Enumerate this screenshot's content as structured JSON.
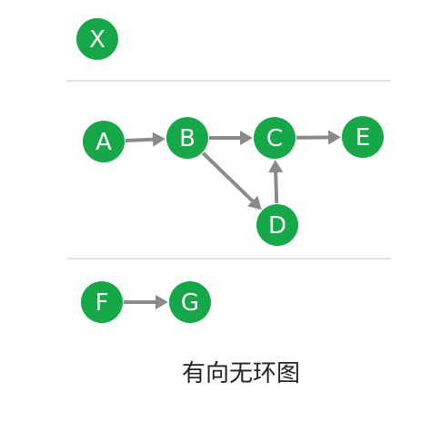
{
  "diagram": {
    "caption": "有向无环图",
    "colors": {
      "node": "#16a848",
      "edge": "#8a8a8a",
      "divider": "#d8d8d8"
    },
    "nodes": [
      {
        "id": "X",
        "label": "X"
      },
      {
        "id": "A",
        "label": "A"
      },
      {
        "id": "B",
        "label": "B"
      },
      {
        "id": "C",
        "label": "C"
      },
      {
        "id": "D",
        "label": "D"
      },
      {
        "id": "E",
        "label": "E"
      },
      {
        "id": "F",
        "label": "F"
      },
      {
        "id": "G",
        "label": "G"
      }
    ],
    "edges": [
      {
        "from": "A",
        "to": "B"
      },
      {
        "from": "B",
        "to": "C"
      },
      {
        "from": "C",
        "to": "E"
      },
      {
        "from": "B",
        "to": "D"
      },
      {
        "from": "D",
        "to": "C"
      },
      {
        "from": "F",
        "to": "G"
      }
    ]
  }
}
